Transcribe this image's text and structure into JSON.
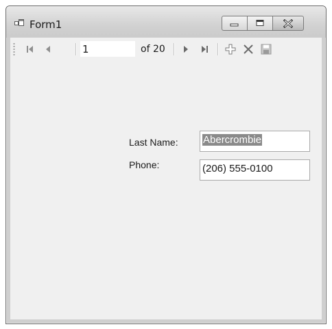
{
  "window": {
    "title": "Form1",
    "icons": {
      "app": "form-app-icon",
      "minimize": "minimize-icon",
      "maximize": "maximize-icon",
      "close": "close-icon"
    }
  },
  "navigator": {
    "position": "1",
    "count_label": "of 20",
    "icons": [
      "move-first-icon",
      "move-previous-icon",
      "move-next-icon",
      "move-last-icon",
      "add-new-icon",
      "delete-icon",
      "save-icon"
    ]
  },
  "form": {
    "last_name_label": "Last Name:",
    "last_name_value": "Abercrombie",
    "phone_label": "Phone:",
    "phone_value": "(206) 555-0100"
  }
}
